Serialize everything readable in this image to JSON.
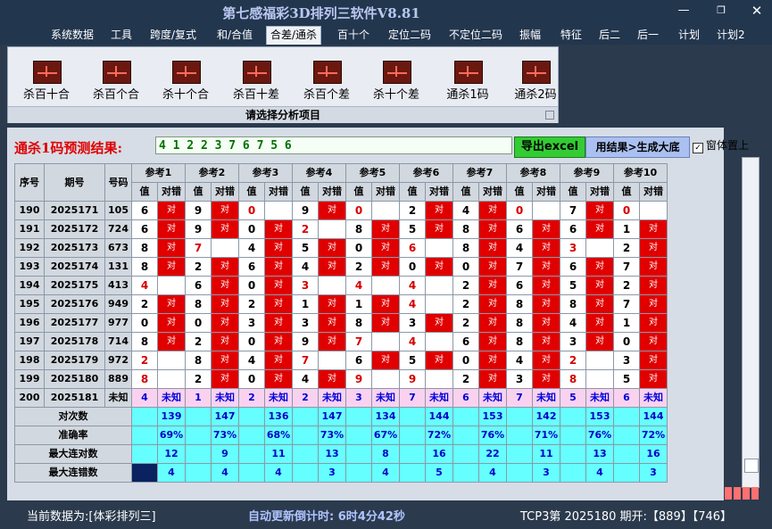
{
  "window": {
    "title": "第七感福彩3D排列三软件V8.81"
  },
  "menu": [
    "系统数据",
    "工具",
    "跨度/复式",
    "和/合值",
    "合差/通杀",
    "百十个",
    "定位二码",
    "不定位二码",
    "振幅",
    "特征",
    "后二",
    "后一",
    "计划",
    "计划2"
  ],
  "menu_active_index": 4,
  "ribbon": {
    "buttons": [
      "杀百十合",
      "杀百个合",
      "杀十个合",
      "杀百十差",
      "杀百个差",
      "杀十个差",
      "通杀1码",
      "通杀2码"
    ],
    "footer": "请选择分析项目"
  },
  "result": {
    "title": "通杀1码预测结果:",
    "sequence": "4 1 2 2 3 7 6 7 5 6",
    "export_button": "导出excel",
    "generate_button": "用结果>生成大底",
    "on_top_label": "窗体置上",
    "on_top_checked": true
  },
  "table": {
    "headers": [
      "序号",
      "期号",
      "号码"
    ],
    "ref_headers": [
      "参考1",
      "参考2",
      "参考3",
      "参考4",
      "参考5",
      "参考6",
      "参考7",
      "参考8",
      "参考9",
      "参考10"
    ],
    "sub_headers": [
      "值",
      "对错"
    ],
    "hit_text": "对",
    "unknown_text": "未知",
    "rows": [
      {
        "seq": "190",
        "period": "2025171",
        "num": "105",
        "vals": [
          [
            "6",
            1
          ],
          [
            "9",
            1
          ],
          [
            "0",
            0
          ],
          [
            "9",
            1
          ],
          [
            "0",
            0
          ],
          [
            "2",
            1
          ],
          [
            "4",
            1
          ],
          [
            "0",
            0
          ],
          [
            "7",
            1
          ],
          [
            "0",
            0
          ]
        ]
      },
      {
        "seq": "191",
        "period": "2025172",
        "num": "724",
        "vals": [
          [
            "6",
            1
          ],
          [
            "9",
            1
          ],
          [
            "0",
            1
          ],
          [
            "2",
            0
          ],
          [
            "8",
            1
          ],
          [
            "5",
            1
          ],
          [
            "8",
            1
          ],
          [
            "6",
            1
          ],
          [
            "6",
            1
          ],
          [
            "1",
            1
          ]
        ]
      },
      {
        "seq": "192",
        "period": "2025173",
        "num": "673",
        "vals": [
          [
            "8",
            1
          ],
          [
            "7",
            0
          ],
          [
            "4",
            1
          ],
          [
            "5",
            1
          ],
          [
            "0",
            1
          ],
          [
            "6",
            0
          ],
          [
            "8",
            1
          ],
          [
            "4",
            1
          ],
          [
            "3",
            0
          ],
          [
            "2",
            1
          ]
        ]
      },
      {
        "seq": "193",
        "period": "2025174",
        "num": "131",
        "vals": [
          [
            "8",
            1
          ],
          [
            "2",
            1
          ],
          [
            "6",
            1
          ],
          [
            "4",
            1
          ],
          [
            "2",
            1
          ],
          [
            "0",
            1
          ],
          [
            "0",
            1
          ],
          [
            "7",
            1
          ],
          [
            "6",
            1
          ],
          [
            "7",
            1
          ]
        ]
      },
      {
        "seq": "194",
        "period": "2025175",
        "num": "413",
        "vals": [
          [
            "4",
            0
          ],
          [
            "6",
            1
          ],
          [
            "0",
            1
          ],
          [
            "3",
            0
          ],
          [
            "4",
            0
          ],
          [
            "4",
            0
          ],
          [
            "2",
            1
          ],
          [
            "6",
            1
          ],
          [
            "5",
            1
          ],
          [
            "2",
            1
          ]
        ]
      },
      {
        "seq": "195",
        "period": "2025176",
        "num": "949",
        "vals": [
          [
            "2",
            1
          ],
          [
            "8",
            1
          ],
          [
            "2",
            1
          ],
          [
            "1",
            1
          ],
          [
            "1",
            1
          ],
          [
            "4",
            0
          ],
          [
            "2",
            1
          ],
          [
            "8",
            1
          ],
          [
            "8",
            1
          ],
          [
            "7",
            1
          ]
        ]
      },
      {
        "seq": "196",
        "period": "2025177",
        "num": "977",
        "vals": [
          [
            "0",
            1
          ],
          [
            "0",
            1
          ],
          [
            "3",
            1
          ],
          [
            "3",
            1
          ],
          [
            "8",
            1
          ],
          [
            "3",
            1
          ],
          [
            "2",
            1
          ],
          [
            "8",
            1
          ],
          [
            "4",
            1
          ],
          [
            "1",
            1
          ]
        ]
      },
      {
        "seq": "197",
        "period": "2025178",
        "num": "714",
        "vals": [
          [
            "8",
            1
          ],
          [
            "2",
            1
          ],
          [
            "0",
            1
          ],
          [
            "9",
            1
          ],
          [
            "7",
            0
          ],
          [
            "4",
            0
          ],
          [
            "6",
            1
          ],
          [
            "8",
            1
          ],
          [
            "3",
            1
          ],
          [
            "0",
            1
          ]
        ]
      },
      {
        "seq": "198",
        "period": "2025179",
        "num": "972",
        "vals": [
          [
            "2",
            0
          ],
          [
            "8",
            1
          ],
          [
            "4",
            1
          ],
          [
            "7",
            0
          ],
          [
            "6",
            1
          ],
          [
            "5",
            1
          ],
          [
            "0",
            1
          ],
          [
            "4",
            1
          ],
          [
            "2",
            0
          ],
          [
            "3",
            1
          ]
        ]
      },
      {
        "seq": "199",
        "period": "2025180",
        "num": "889",
        "vals": [
          [
            "8",
            0
          ],
          [
            "2",
            1
          ],
          [
            "0",
            1
          ],
          [
            "4",
            1
          ],
          [
            "9",
            0
          ],
          [
            "9",
            0
          ],
          [
            "2",
            1
          ],
          [
            "3",
            1
          ],
          [
            "8",
            0
          ],
          [
            "5",
            1
          ]
        ]
      }
    ],
    "pending": {
      "seq": "200",
      "period": "2025181",
      "num": "未知",
      "vals": [
        "4",
        "1",
        "2",
        "2",
        "3",
        "7",
        "6",
        "7",
        "5",
        "6"
      ]
    },
    "stats": [
      {
        "label": "对次数",
        "vals": [
          "139",
          "147",
          "136",
          "147",
          "134",
          "144",
          "153",
          "142",
          "153",
          "144"
        ]
      },
      {
        "label": "准确率",
        "vals": [
          "69%",
          "73%",
          "68%",
          "73%",
          "67%",
          "72%",
          "76%",
          "71%",
          "76%",
          "72%"
        ]
      },
      {
        "label": "最大连对数",
        "vals": [
          "12",
          "9",
          "11",
          "13",
          "8",
          "16",
          "22",
          "11",
          "13",
          "16"
        ]
      },
      {
        "label": "最大连错数",
        "vals": [
          "4",
          "4",
          "4",
          "3",
          "4",
          "5",
          "4",
          "3",
          "4",
          "3"
        ]
      }
    ]
  },
  "status": {
    "source": "当前数据为:[体彩排列三]",
    "countdown": "自动更新倒计时: 6时4分42秒",
    "draw": "TCP3第 2025180 期开:【889】【746】"
  }
}
